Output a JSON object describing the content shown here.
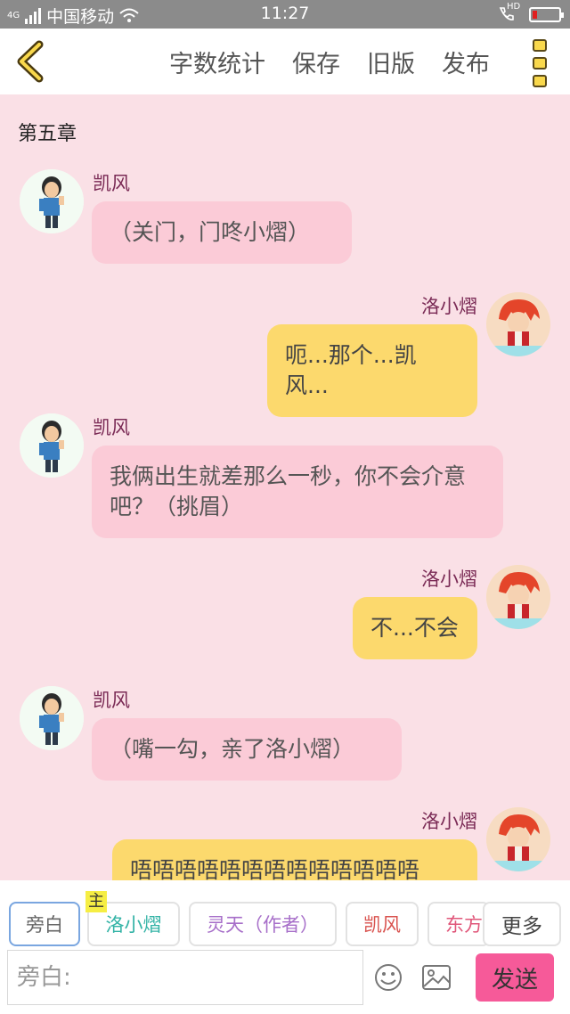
{
  "status_bar": {
    "network": "4G",
    "carrier": "中国移动",
    "time": "11:27",
    "hd": "HD"
  },
  "toolbar": {
    "word_count": "字数统计",
    "save": "保存",
    "old_version": "旧版",
    "publish": "发布"
  },
  "chapter_title": "第五章",
  "messages": [
    {
      "speaker": "凯风",
      "side": "left",
      "text": "（关门，门咚小熠）"
    },
    {
      "speaker": "洛小熠",
      "side": "right",
      "text": "呃...那个...凯风..."
    },
    {
      "speaker": "凯风",
      "side": "left",
      "text": "我俩出生就差那么一秒，你不会介意吧？（挑眉）"
    },
    {
      "speaker": "洛小熠",
      "side": "right",
      "text": "不...不会"
    },
    {
      "speaker": "凯风",
      "side": "left",
      "text": "（嘴一勾，亲了洛小熠）"
    },
    {
      "speaker": "洛小熠",
      "side": "right",
      "text": "唔唔唔唔唔唔唔唔唔唔唔唔唔"
    }
  ],
  "roles": {
    "narration": "旁白",
    "main_badge": "主",
    "luo": "洛小熠",
    "lingtian": "灵天（作者）",
    "kaifeng": "凯风",
    "dongfang": "东方",
    "more": "更多"
  },
  "input": {
    "placeholder": "旁白:",
    "value": ""
  },
  "send_label": "发送",
  "colors": {
    "background": "#fae0e6",
    "left_bubble": "#fbcbd7",
    "right_bubble": "#fcd96d",
    "send_button": "#f65a99",
    "speaker_name": "#7a2a55",
    "role_luo": "#33b3a6",
    "role_lingtian": "#a76fc9",
    "role_kaifeng": "#d9534f",
    "role_dongfang": "#e0577a"
  }
}
